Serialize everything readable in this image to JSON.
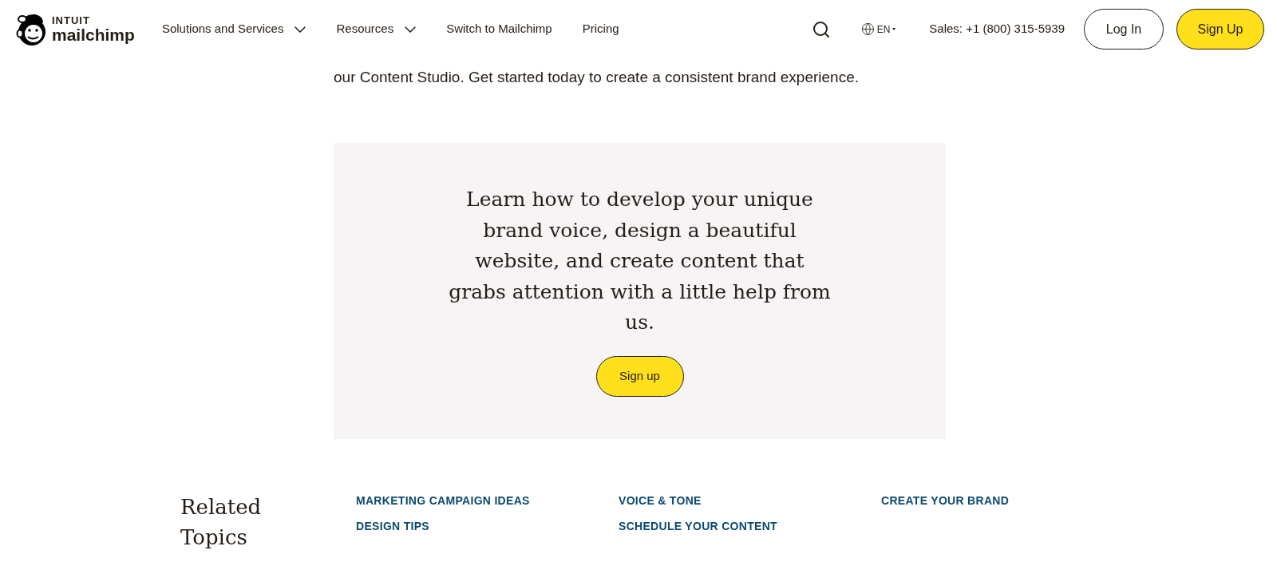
{
  "header": {
    "logo": {
      "brand": "INTUIT",
      "product": "mailchimp"
    },
    "nav": [
      {
        "label": "Solutions and Services",
        "dropdown": true
      },
      {
        "label": "Resources",
        "dropdown": true
      },
      {
        "label": "Switch to Mailchimp",
        "dropdown": false
      },
      {
        "label": "Pricing",
        "dropdown": false
      }
    ],
    "language": "EN",
    "sales": "Sales: +1 (800) 315-5939",
    "buttons": [
      {
        "label": "Log In",
        "kind": "outline"
      },
      {
        "label": "Sign Up",
        "kind": "primary"
      }
    ]
  },
  "intro": "our Content Studio. Get started today to create a consistent brand experience.",
  "cta": {
    "headline": "Learn how to develop your unique brand voice, design a beautiful website, and create content that grabs attention with a little help from us.",
    "button": "Sign up"
  },
  "related": {
    "title": "Related Topics",
    "links": [
      "MARKETING CAMPAIGN IDEAS",
      "DESIGN TIPS",
      "VOICE & TONE",
      "SCHEDULE YOUR CONTENT",
      "CREATE YOUR BRAND"
    ]
  }
}
